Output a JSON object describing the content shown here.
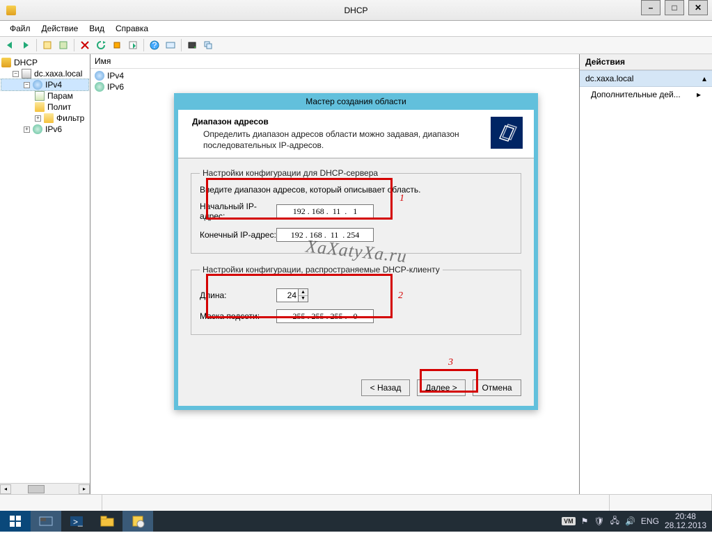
{
  "window": {
    "title": "DHCP"
  },
  "menu": {
    "file": "Файл",
    "action": "Действие",
    "view": "Вид",
    "help": "Справка"
  },
  "tree": {
    "root": "DHCP",
    "server": "dc.xaxa.local",
    "ipv4": "IPv4",
    "param": "Парам",
    "policy": "Полит",
    "filters": "Фильтр",
    "ipv6": "IPv6"
  },
  "list": {
    "header": "Имя",
    "ipv4": "IPv4",
    "ipv6": "IPv6"
  },
  "actions": {
    "header": "Действия",
    "context": "dc.xaxa.local",
    "more": "Дополнительные дей..."
  },
  "wizard": {
    "title": "Мастер создания области",
    "head_title": "Диапазон адресов",
    "head_desc": "Определить диапазон адресов области можно задавая, диапазон последовательных IP-адресов.",
    "group1_legend": "Настройки конфигурации для DHCP-сервера",
    "group1_hint": "Введите диапазон адресов, который описывает область.",
    "start_label": "Начальный IP-адрес:",
    "start_value": "192 . 168 .  11  .   1",
    "end_label": "Конечный IP-адрес:",
    "end_value": "192 . 168 .  11  . 254",
    "group2_legend": "Настройки конфигурации, распространяемые DHCP-клиенту",
    "length_label": "Длина:",
    "length_value": "24",
    "mask_label": "Маска подсети:",
    "mask_value": "255 . 255 . 255 .   0",
    "back": "< Назад",
    "next": "Далее >",
    "cancel": "Отмена"
  },
  "annotations": {
    "n1": "1",
    "n2": "2",
    "n3": "3"
  },
  "watermark": "XaXatyXa.ru",
  "taskbar": {
    "lang": "ENG",
    "time": "20:48",
    "date": "28.12.2013"
  }
}
